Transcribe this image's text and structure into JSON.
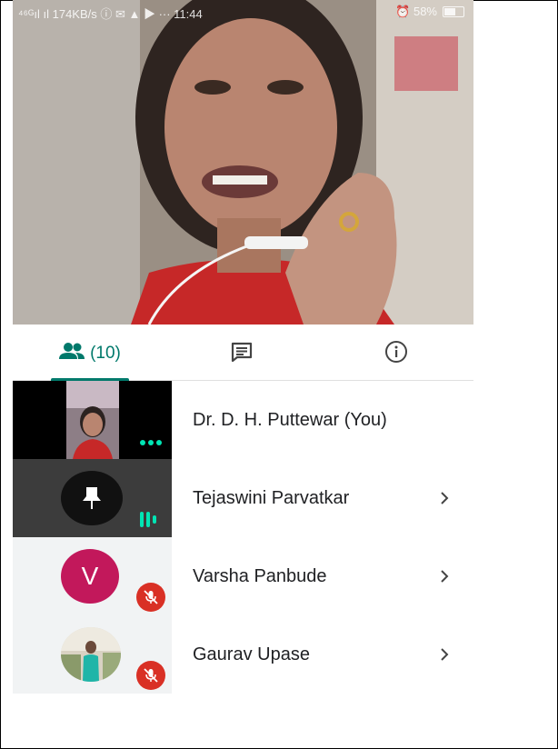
{
  "status_bar": {
    "left": "⁴⁶ᴳıl ıl 174KB/s ⓘ ✉ ▲ ▶ ···  11:44",
    "right": "⏰ 58%"
  },
  "tabs": {
    "people_count": "(10)"
  },
  "participants": [
    {
      "name": "Dr. D. H. Puttewar (You)"
    },
    {
      "name": "Tejaswini Parvatkar"
    },
    {
      "name": "Varsha Panbude",
      "initial": "V"
    },
    {
      "name": "Gaurav Upase"
    }
  ],
  "colors": {
    "accent": "#00796b",
    "mute": "#d93025",
    "avatar_v": "#c2185b",
    "speaking": "#00e5b4"
  }
}
